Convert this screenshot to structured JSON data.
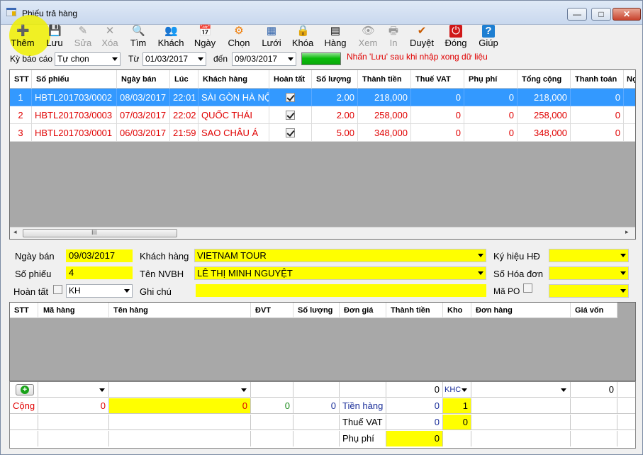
{
  "window": {
    "title": "Phiếu trả hàng"
  },
  "window_controls": {
    "minimize": "—",
    "maximize": "□",
    "close": "✕"
  },
  "toolbar": [
    {
      "name": "add",
      "label": "Thêm",
      "icon": "➕",
      "enabled": true
    },
    {
      "name": "save",
      "label": "Lưu",
      "icon": "💾",
      "enabled": true
    },
    {
      "name": "edit",
      "label": "Sửa",
      "icon": "✎",
      "enabled": false
    },
    {
      "name": "delete",
      "label": "Xóa",
      "icon": "✕",
      "enabled": false
    },
    {
      "name": "find",
      "label": "Tìm",
      "icon": "🔍",
      "enabled": true
    },
    {
      "name": "customer",
      "label": "Khách",
      "icon": "👥",
      "enabled": true
    },
    {
      "name": "date",
      "label": "Ngày",
      "icon": "📅",
      "enabled": true
    },
    {
      "name": "choose",
      "label": "Chọn",
      "icon": "⚙",
      "enabled": true
    },
    {
      "name": "grid",
      "label": "Lưới",
      "icon": "▦",
      "enabled": true
    },
    {
      "name": "lock",
      "label": "Khóa",
      "icon": "🔒",
      "enabled": true
    },
    {
      "name": "goods",
      "label": "Hàng",
      "icon": "▤",
      "enabled": true
    },
    {
      "name": "view",
      "label": "Xem",
      "icon": "👁",
      "enabled": false
    },
    {
      "name": "print",
      "label": "In",
      "icon": "🖶",
      "enabled": false
    },
    {
      "name": "approve",
      "label": "Duyệt",
      "icon": "✔",
      "enabled": true
    },
    {
      "name": "close",
      "label": "Đóng",
      "icon": "⏻",
      "enabled": true
    },
    {
      "name": "help",
      "label": "Giúp",
      "icon": "?",
      "enabled": true
    }
  ],
  "period": {
    "label": "Kỳ báo cáo",
    "value": "Tự chọn",
    "from_label": "Từ",
    "from": "01/03/2017",
    "to_label": "đến",
    "to": "09/03/2017",
    "notice": "Nhấn 'Lưu' sau khi nhập xong dữ liệu"
  },
  "list": {
    "columns": [
      "STT",
      "Số phiếu",
      "Ngày bán",
      "Lúc",
      "Khách hàng",
      "Hoàn tất",
      "Số lượng",
      "Thành tiền",
      "Thuế VAT",
      "Phụ phí",
      "Tổng cộng",
      "Thanh toán",
      "Nợ"
    ],
    "rows": [
      {
        "stt": "1",
        "so_phieu": "HBTL201703/0002",
        "ngay_ban": "08/03/2017",
        "luc": "22:01",
        "khach_hang": "SÀI GÒN HÀ NỘI",
        "hoan_tat": true,
        "so_luong": "2.00",
        "thanh_tien": "218,000",
        "thue_vat": "0",
        "phu_phi": "0",
        "tong_cong": "218,000",
        "thanh_toan": "0",
        "no": ""
      },
      {
        "stt": "2",
        "so_phieu": "HBTL201703/0003",
        "ngay_ban": "07/03/2017",
        "luc": "22:02",
        "khach_hang": "QUỐC THÁI",
        "hoan_tat": true,
        "so_luong": "2.00",
        "thanh_tien": "258,000",
        "thue_vat": "0",
        "phu_phi": "0",
        "tong_cong": "258,000",
        "thanh_toan": "0",
        "no": ""
      },
      {
        "stt": "3",
        "so_phieu": "HBTL201703/0001",
        "ngay_ban": "06/03/2017",
        "luc": "21:59",
        "khach_hang": "SAO CHÂU Á",
        "hoan_tat": true,
        "so_luong": "5.00",
        "thanh_tien": "348,000",
        "thue_vat": "0",
        "phu_phi": "0",
        "tong_cong": "348,000",
        "thanh_toan": "0",
        "no": ""
      }
    ],
    "scroll": {
      "left": "◂",
      "grip": "III",
      "right": "▸"
    }
  },
  "form": {
    "ngay_ban_label": "Ngày bán",
    "ngay_ban": "09/03/2017",
    "so_phieu_label": "Số phiếu",
    "so_phieu": "4",
    "hoan_tat_label": "Hoàn tất",
    "kho": "KH",
    "khach_hang_label": "Khách hàng",
    "khach_hang": "VIETNAM TOUR",
    "nvbh_label": "Tên NVBH",
    "nvbh": "LÊ THỊ MINH NGUYỆT",
    "ghi_chu_label": "Ghi chú",
    "ghi_chu": "",
    "ky_hieu_label": "Ký hiệu HĐ",
    "ky_hieu": "",
    "so_hoa_don_label": "Số Hóa đơn",
    "so_hoa_don": "",
    "ma_po_label": "Mã PO",
    "ma_po": ""
  },
  "detail": {
    "columns": [
      "STT",
      "Mã hàng",
      "Tên hàng",
      "ĐVT",
      "Số lượng",
      "Đơn giá",
      "Thành tiền",
      "Kho",
      "Đơn hàng",
      "Giá vốn"
    ]
  },
  "footer": {
    "entry_thanh_tien": "0",
    "entry_kho": "KHC",
    "entry_gia_von": "0",
    "cong_label": "Cộng",
    "cong_stt": "0",
    "cong_ten_hang": "0",
    "cong_so_luong": "0",
    "cong_don_gia": "0",
    "tien_hang_label": "Tiền hàng",
    "tien_hang": "0",
    "tien_hang_kho": "1",
    "thue_vat_label": "Thuế VAT",
    "thue_vat": "0",
    "thue_vat_kho": "0",
    "phu_phi_label": "Phụ phí",
    "phu_phi": "0"
  },
  "colors": {
    "accent_red": "#e00000",
    "highlight_yellow": "#ffff00",
    "selection_blue": "#3399ff",
    "tien_hang_blue": "#1b2f9a"
  }
}
